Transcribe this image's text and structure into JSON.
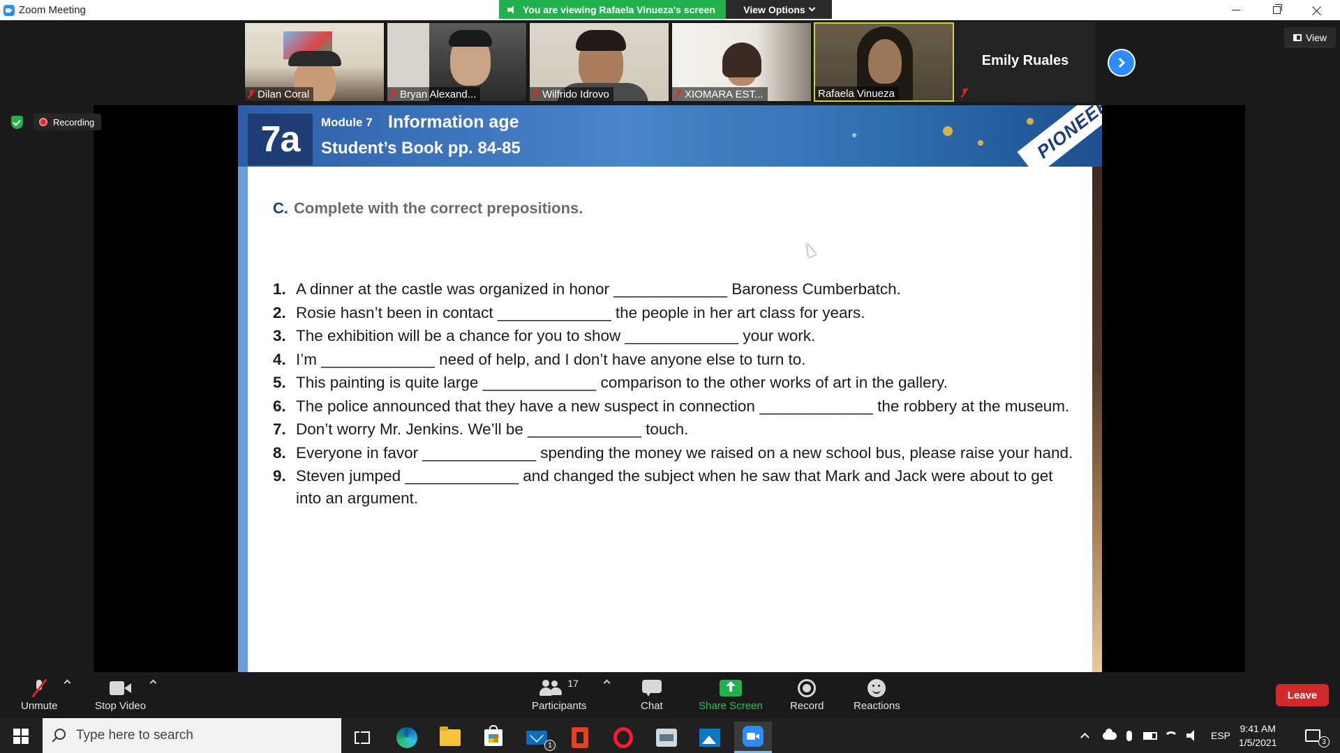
{
  "window": {
    "title": "Zoom Meeting",
    "viewing_banner": "You are viewing Rafaela Vinueza's screen",
    "view_options_label": "View Options"
  },
  "gallery": {
    "participants": [
      {
        "name": "Dilan Coral",
        "muted": true
      },
      {
        "name": "Bryan Alexand...",
        "muted": true
      },
      {
        "name": "Wilfrido Idrovo",
        "muted": true
      },
      {
        "name": "XIOMARA EST...",
        "muted": true
      },
      {
        "name": "Rafaela Vinueza",
        "muted": false
      }
    ],
    "featured_name": "Emily Ruales",
    "view_label": "View"
  },
  "status": {
    "recording_label": "Recording"
  },
  "document": {
    "unit": "7a",
    "module": "Module 7",
    "module_title": "Information age",
    "book_pages": "Student’s Book pp. 84-85",
    "logo_text": "PIONEER",
    "instruction_mark": "C.",
    "instruction": "Complete with the correct prepositions.",
    "items": [
      {
        "num": "1.",
        "text": "A dinner at the castle was organized in honor _____________ Baroness Cumberbatch."
      },
      {
        "num": "2.",
        "text": "Rosie hasn’t been in contact _____________ the people in her art class for years."
      },
      {
        "num": "3.",
        "text": "The exhibition will be a chance for you to show _____________ your work."
      },
      {
        "num": "4.",
        "text": "I’m _____________ need of help, and I don’t have anyone else to turn to."
      },
      {
        "num": "5.",
        "text": "This painting is quite large _____________ comparison to the other works of art in the gallery."
      },
      {
        "num": "6.",
        "text": "The police announced that they have a new suspect in connection _____________ the robbery at the museum."
      },
      {
        "num": "7.",
        "text": "Don’t worry Mr. Jenkins. We’ll be _____________ touch."
      },
      {
        "num": "8.",
        "text": "Everyone in favor _____________ spending the money we raised on a new school bus, please raise your hand."
      },
      {
        "num": "9.",
        "text": "Steven jumped _____________ and changed the subject when he saw that Mark and Jack were about to get into an argument."
      }
    ]
  },
  "toolbar": {
    "unmute": "Unmute",
    "stop_video": "Stop Video",
    "participants": "Participants",
    "participant_count": "17",
    "chat": "Chat",
    "share_screen": "Share Screen",
    "record": "Record",
    "reactions": "Reactions",
    "leave": "Leave"
  },
  "taskbar": {
    "search_placeholder": "Type here to search",
    "mail_badge": "1",
    "language": "ESP",
    "time": "9:41 AM",
    "date": "1/5/2021",
    "notifications": "3"
  },
  "colors": {
    "zoom_blue": "#2d8cff",
    "banner_green": "#23b14d",
    "leave_red": "#d12a2a",
    "book_navy": "#1d3d74"
  }
}
